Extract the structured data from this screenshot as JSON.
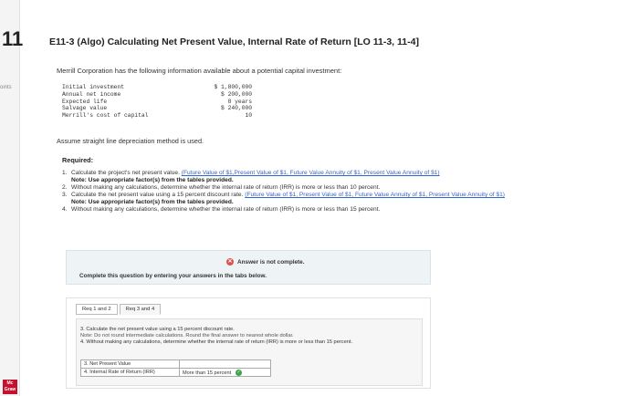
{
  "question": {
    "number": "11",
    "points_label": "oints"
  },
  "brand": {
    "logo_text": "Mc Graw"
  },
  "title": "E11-3 (Algo) Calculating Net Present Value, Internal Rate of Return [LO 11-3, 11-4]",
  "intro": "Merrill Corporation has the following information available about a potential capital investment:",
  "given": [
    {
      "label": "Initial investment",
      "value": "$ 1,800,000"
    },
    {
      "label": "Annual net income",
      "value": "$ 200,000"
    },
    {
      "label": "Expected life",
      "value": "8 years"
    },
    {
      "label": "Salvage value",
      "value": "$ 240,000"
    },
    {
      "label": "Merrill's cost of capital",
      "value": "10"
    }
  ],
  "depreciation_note": "Assume straight line depreciation method is used.",
  "required_label": "Required:",
  "requirements": [
    {
      "num": "1.",
      "text": "Calculate the project's net present value. ",
      "links": "(Future Value of $1,Present Value of $1, Future Value Annuity of $1, Present Value Annuity of $1)",
      "note": "Note: Use appropriate factor(s) from the tables provided."
    },
    {
      "num": "2.",
      "text": "Without making any calculations, determine whether the internal rate of return (IRR) is more or less than 10 percent.",
      "links": "",
      "note": ""
    },
    {
      "num": "3.",
      "text": "Calculate the net present value using a 15 percent discount rate. ",
      "links": "(Future Value of $1, Present Value of $1, Future Value Annuity of $1, Present Value Annuity of $1)",
      "note": "Note: Use appropriate factor(s) from the tables provided."
    },
    {
      "num": "4.",
      "text": "Without making any calculations, determine whether the internal rate of return (IRR) is more or less than 15 percent.",
      "links": "",
      "note": ""
    }
  ],
  "status": {
    "icon": "x-icon",
    "text": "Answer is not complete."
  },
  "complete_msg": "Complete this question by entering your answers in the tabs below.",
  "tabs": [
    {
      "label": "Req 1 and 2",
      "active": false
    },
    {
      "label": "Req 3 and 4",
      "active": true
    }
  ],
  "instructions": {
    "line1": "3. Calculate the net present value using a 15 percent discount rate.",
    "line2": "Note: Do not round intermediate calculations. Round the final answer to nearest whole dollar.",
    "line3": "4. Without making any calculations, determine whether the internal rate of return (IRR) is more or less than 15 percent."
  },
  "answers": [
    {
      "label": "3. Net Present Value",
      "value": ""
    },
    {
      "label": "4. Internal Rate of Return (IRR)",
      "value": "More than 15 percent",
      "correct": true
    }
  ],
  "colors": {
    "link": "#3366cc",
    "error": "#d9534f",
    "success": "#3aa34b",
    "panel": "#eef3f6"
  }
}
